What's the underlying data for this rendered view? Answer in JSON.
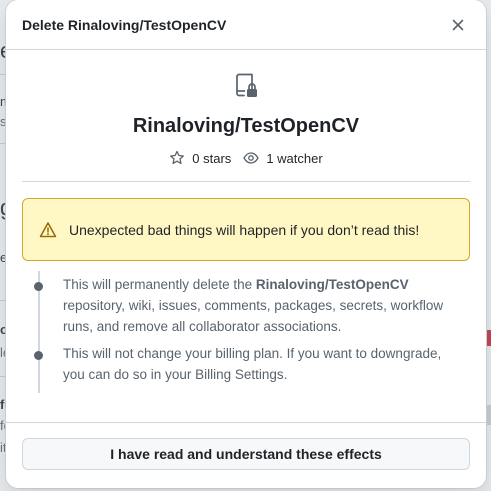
{
  "background": {
    "fragments": [
      "e",
      "m",
      "s",
      "g",
      "e",
      "ol",
      "le",
      "fe",
      "fe",
      "it"
    ]
  },
  "dialog": {
    "title": "Delete Rinaloving/TestOpenCV",
    "close_icon": "x-icon",
    "repo": {
      "icon": "repo-locked-icon",
      "name": "Rinaloving/TestOpenCV",
      "stars": "0 stars",
      "watchers": "1 watcher"
    },
    "warning": {
      "icon": "alert-triangle-icon",
      "text": "Unexpected bad things will happen if you don’t read this!"
    },
    "effects": [
      {
        "before": "This will permanently delete the ",
        "bold": "Rinaloving/TestOpenCV",
        "after": " repository, wiki, issues, comments, packages, secrets, workflow runs, and remove all collaborator associations."
      },
      {
        "before": "This will not change your billing plan. If you want to downgrade, you can do so in your Billing Settings.",
        "bold": "",
        "after": ""
      }
    ],
    "confirm_label": "I have read and understand these effects"
  },
  "colors": {
    "warning_bg": "#fff8c5",
    "warning_border": "#d4a72c",
    "muted_text": "#59636e",
    "border": "#d0d7de"
  }
}
